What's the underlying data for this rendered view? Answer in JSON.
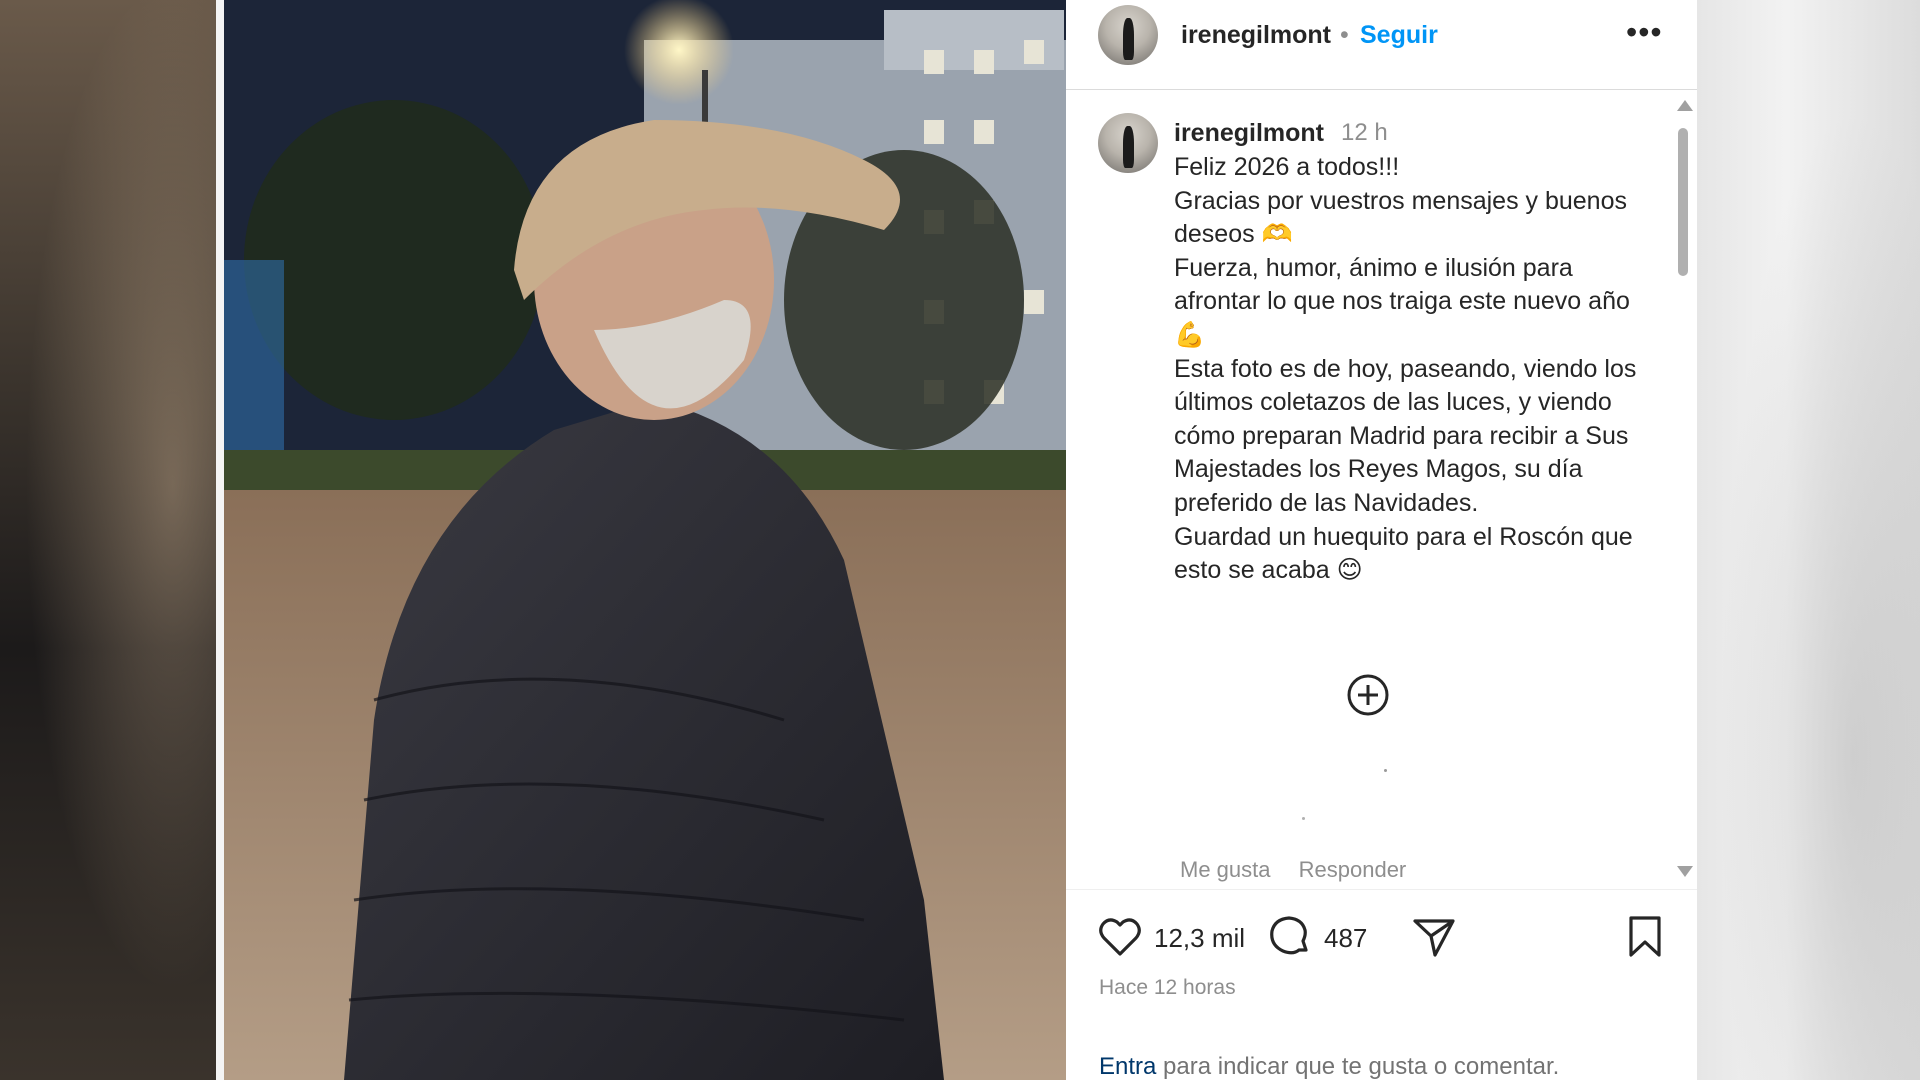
{
  "post": {
    "username": "irenegilmont",
    "separator": "•",
    "follow_label": "Seguir",
    "more_label": "•••"
  },
  "comment": {
    "username": "irenegilmont",
    "time": "12 h",
    "caption": "Feliz 2026 a todos!!!\nGracias por vuestros mensajes y buenos deseos 🫶\nFuerza, humor, ánimo e ilusión para afrontar lo que nos traiga este nuevo año 💪\nEsta foto es de hoy, paseando, viendo los últimos coletazos de las luces, y viendo cómo preparan Madrid para recibir a Sus Majestades los Reyes Magos, su día preferido de las Navidades.\nGuardad un huequito para el Roscón que esto se acaba 😊",
    "like_label": "Me gusta",
    "reply_label": "Responder"
  },
  "actions": {
    "likes": "12,3 mil",
    "comments": "487",
    "posted": "Hace 12 horas"
  },
  "login": {
    "link": "Entra",
    "rest": " para indicar que te gusta o comentar."
  },
  "icons": {
    "like": "heart-icon",
    "comment": "comment-bubble-icon",
    "share": "share-paper-plane-icon",
    "save": "bookmark-icon",
    "add": "plus-circle-icon",
    "more": "more-options-icon"
  },
  "colors": {
    "accent": "#0095f6",
    "text": "#262626",
    "muted": "#8e8e8e",
    "link": "#00376b"
  }
}
